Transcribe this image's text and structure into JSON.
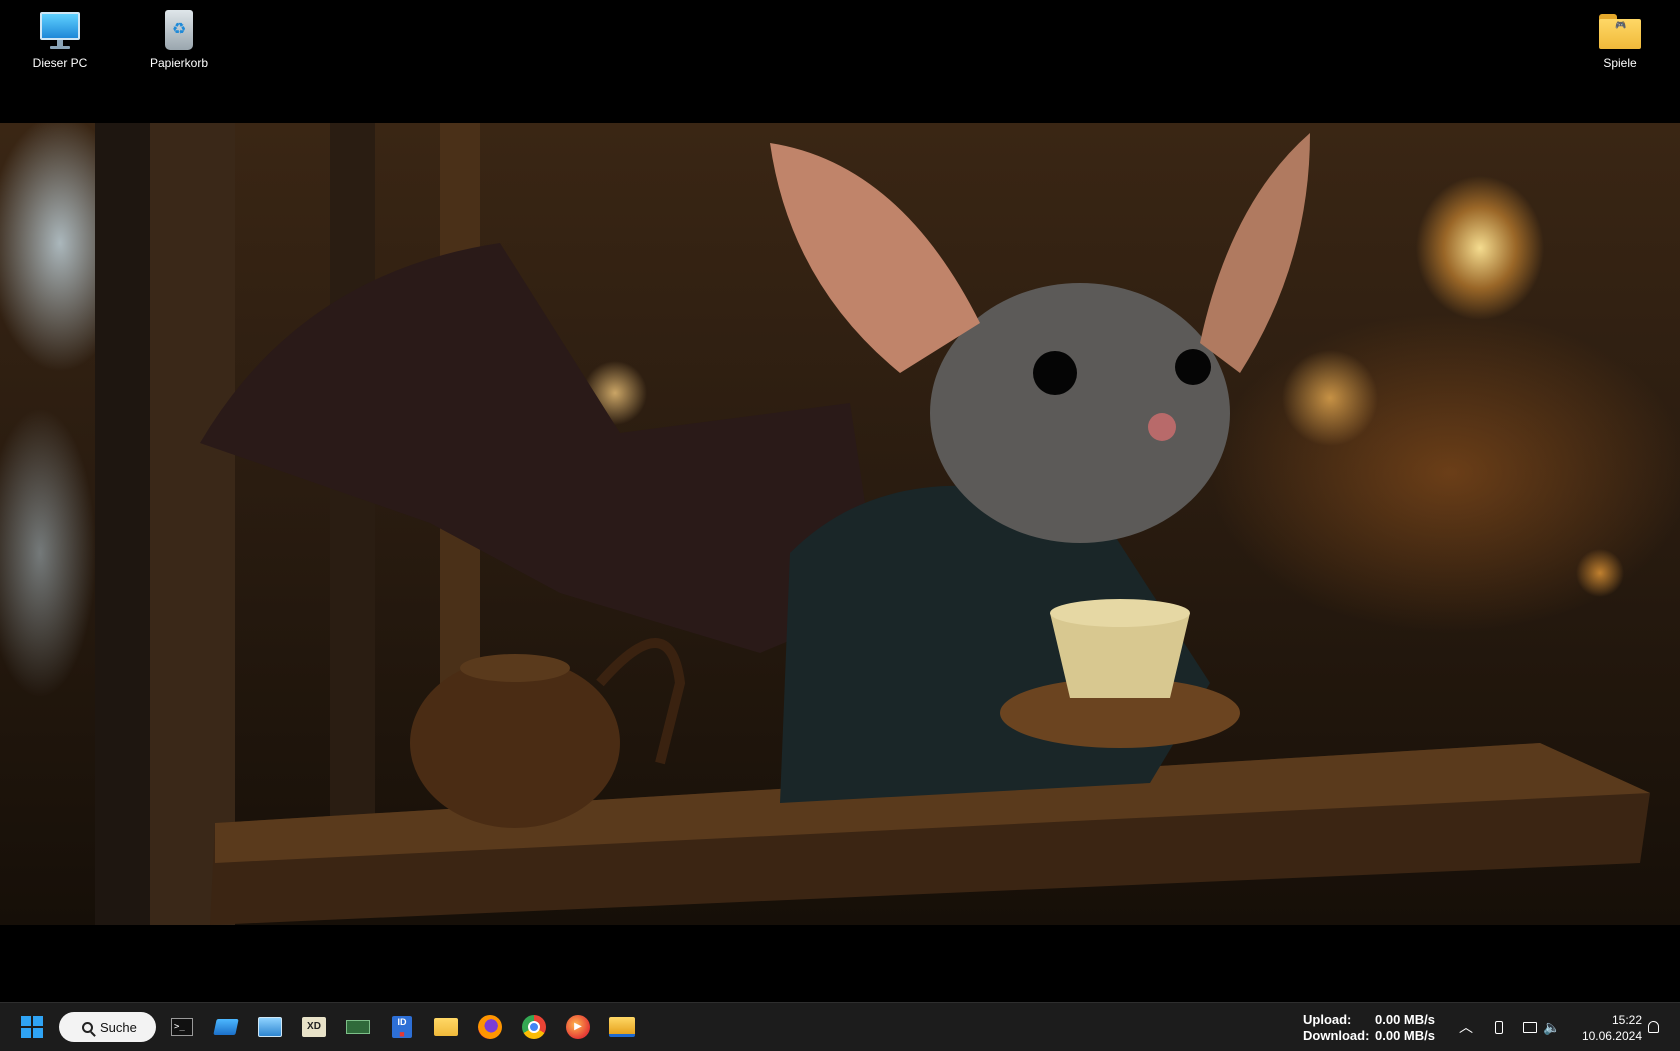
{
  "desktop": {
    "icons": [
      {
        "label": "Dieser PC"
      },
      {
        "label": "Papierkorb"
      },
      {
        "label": "Spiele"
      }
    ]
  },
  "taskbar": {
    "search": {
      "label": "Suche"
    },
    "apps": [
      "start-icon",
      "terminal-icon",
      "window-app-icon",
      "control-panel-icon",
      "xd-app-icon",
      "ram-monitor-icon",
      "id-app-icon",
      "file-explorer-icon",
      "firefox-icon",
      "chrome-icon",
      "media-player-icon",
      "folder-app-icon"
    ],
    "net_speed": {
      "upload_label": "Upload:",
      "upload_value": "0.00 MB/s",
      "download_label": "Download:",
      "download_value": "0.00 MB/s"
    },
    "clock": {
      "time": "15:22",
      "date": "10.06.2024"
    }
  },
  "colors": {
    "taskbar_bg": "#1c1c1c",
    "accent_blue": "#1f8ad8",
    "folder_yellow": "#f6c443"
  }
}
